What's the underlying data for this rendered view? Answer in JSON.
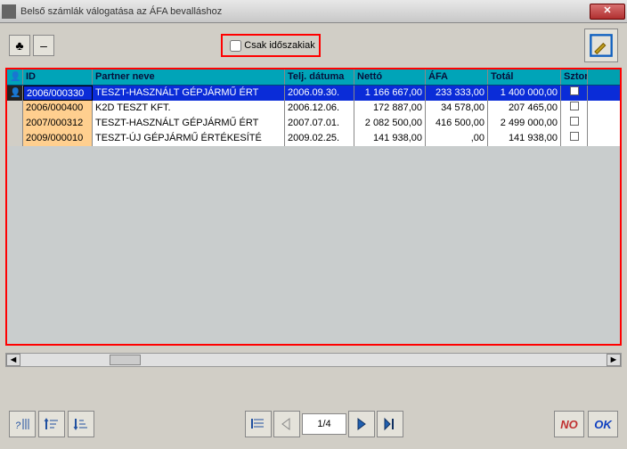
{
  "window": {
    "title": "Belső számlák válogatása az ÁFA bevalláshoz",
    "close": "✕"
  },
  "toolbar": {
    "club": "♣",
    "minus": "–",
    "checkbox_label": "Csak időszakiak"
  },
  "grid": {
    "headers": {
      "id": "ID",
      "partner": "Partner neve",
      "date": "Telj. dátuma",
      "netto": "Nettó",
      "afa": "ÁFA",
      "total": "Totál",
      "szt": "Sztor"
    },
    "rows": [
      {
        "id": "2006/000330",
        "partner": "TESZT-HASZNÁLT GÉPJÁRMŰ ÉRT",
        "date": "2006.09.30.",
        "netto": "1 166 667,00",
        "afa": "233 333,00",
        "total": "1 400 000,00",
        "selected": true
      },
      {
        "id": "2006/000400",
        "partner": "K2D TESZT KFT.",
        "date": "2006.12.06.",
        "netto": "172 887,00",
        "afa": "34 578,00",
        "total": "207 465,00",
        "selected": false
      },
      {
        "id": "2007/000312",
        "partner": "TESZT-HASZNÁLT GÉPJÁRMŰ ÉRT",
        "date": "2007.07.01.",
        "netto": "2 082 500,00",
        "afa": "416 500,00",
        "total": "2 499 000,00",
        "selected": false
      },
      {
        "id": "2009/000010",
        "partner": "TESZT-ÚJ GÉPJÁRMŰ ÉRTÉKESÍTÉ",
        "date": "2009.02.25.",
        "netto": "141 938,00",
        "afa": ",00",
        "total": "141 938,00",
        "selected": false
      }
    ]
  },
  "pager": {
    "indicator": "1/4"
  },
  "buttons": {
    "no": "NO",
    "ok": "OK"
  }
}
